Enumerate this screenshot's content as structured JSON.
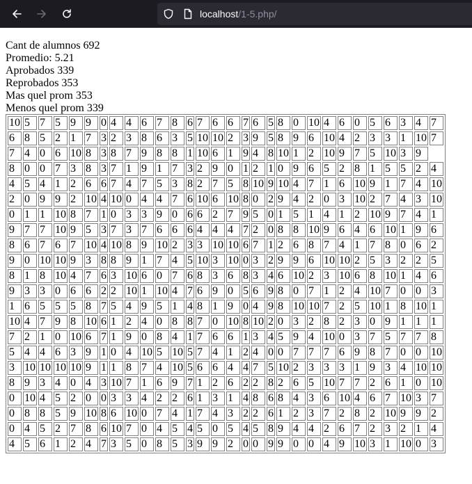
{
  "browser": {
    "url_host": "localhost",
    "url_path": "/1-5.php/"
  },
  "stats": {
    "cant": "Cant de alumnos 692",
    "promedio": "Promedio: 5.21",
    "aprobados": "Aprobados 339",
    "reprobados": "Reprobados 353",
    "mas": "Mas quel prom 353",
    "menos": "Menos quel prom 339"
  },
  "grid": [
    [
      "10",
      "5",
      "7",
      "5",
      "9",
      "9",
      "0",
      "4",
      "4",
      "6",
      "7",
      "8",
      "6",
      "7",
      "6",
      "6",
      "7",
      "6",
      "5",
      "8",
      "0",
      "10",
      "4",
      "6",
      "0",
      "5",
      "6",
      "3",
      "4",
      "7"
    ],
    [
      "6",
      "8",
      "5",
      "2",
      "1",
      "7",
      "3",
      "2",
      "3",
      "8",
      "6",
      "3",
      "5",
      "10",
      "10",
      "2",
      "3",
      "9",
      "5",
      "8",
      "9",
      "6",
      "10",
      "4",
      "2",
      "3",
      "3",
      "1",
      "10",
      "7"
    ],
    [
      "7",
      "4",
      "0",
      "6",
      "10",
      "8",
      "3",
      "8",
      "7",
      "9",
      "8",
      "8",
      "1",
      "10",
      "6",
      "1",
      "9",
      "4",
      "8",
      "10",
      "1",
      "2",
      "10",
      "9",
      "7",
      "5",
      "10",
      "3",
      "9"
    ],
    [
      "8",
      "0",
      "0",
      "7",
      "3",
      "8",
      "3",
      "7",
      "1",
      "9",
      "1",
      "7",
      "3",
      "2",
      "9",
      "0",
      "1",
      "2",
      "1",
      "0",
      "9",
      "6",
      "5",
      "2",
      "8",
      "1",
      "5",
      "5",
      "2",
      "4"
    ],
    [
      "4",
      "5",
      "4",
      "1",
      "2",
      "6",
      "6",
      "7",
      "4",
      "7",
      "5",
      "3",
      "8",
      "2",
      "7",
      "5",
      "8",
      "10",
      "9",
      "10",
      "4",
      "7",
      "1",
      "6",
      "10",
      "9",
      "1",
      "7",
      "4",
      "10"
    ],
    [
      "2",
      "0",
      "9",
      "9",
      "2",
      "10",
      "4",
      "10",
      "0",
      "4",
      "4",
      "7",
      "6",
      "10",
      "6",
      "10",
      "8",
      "0",
      "2",
      "9",
      "4",
      "2",
      "0",
      "3",
      "10",
      "2",
      "7",
      "4",
      "3",
      "10"
    ],
    [
      "0",
      "1",
      "1",
      "10",
      "8",
      "7",
      "1",
      "0",
      "3",
      "3",
      "9",
      "0",
      "6",
      "6",
      "2",
      "7",
      "9",
      "5",
      "0",
      "1",
      "5",
      "1",
      "4",
      "1",
      "2",
      "10",
      "9",
      "7",
      "4",
      "1"
    ],
    [
      "9",
      "7",
      "7",
      "10",
      "9",
      "5",
      "3",
      "7",
      "3",
      "7",
      "6",
      "6",
      "6",
      "4",
      "4",
      "4",
      "7",
      "2",
      "0",
      "8",
      "8",
      "10",
      "9",
      "6",
      "4",
      "6",
      "10",
      "1",
      "9",
      "6"
    ],
    [
      "8",
      "6",
      "7",
      "6",
      "7",
      "10",
      "4",
      "10",
      "8",
      "9",
      "10",
      "2",
      "3",
      "3",
      "10",
      "10",
      "6",
      "7",
      "1",
      "2",
      "6",
      "8",
      "7",
      "4",
      "1",
      "7",
      "8",
      "0",
      "6",
      "2"
    ],
    [
      "9",
      "0",
      "10",
      "10",
      "9",
      "3",
      "8",
      "8",
      "9",
      "1",
      "7",
      "4",
      "5",
      "10",
      "3",
      "10",
      "0",
      "3",
      "2",
      "9",
      "9",
      "6",
      "10",
      "10",
      "2",
      "5",
      "3",
      "2",
      "2",
      "5"
    ],
    [
      "8",
      "1",
      "8",
      "10",
      "4",
      "7",
      "6",
      "3",
      "10",
      "6",
      "0",
      "7",
      "6",
      "8",
      "3",
      "6",
      "8",
      "3",
      "4",
      "6",
      "10",
      "2",
      "3",
      "10",
      "6",
      "8",
      "10",
      "1",
      "4",
      "6"
    ],
    [
      "9",
      "3",
      "3",
      "0",
      "6",
      "6",
      "2",
      "2",
      "10",
      "1",
      "10",
      "4",
      "7",
      "6",
      "9",
      "0",
      "5",
      "6",
      "9",
      "8",
      "0",
      "7",
      "1",
      "2",
      "4",
      "10",
      "7",
      "0",
      "0",
      "3"
    ],
    [
      "1",
      "6",
      "5",
      "5",
      "5",
      "8",
      "7",
      "5",
      "4",
      "9",
      "5",
      "1",
      "4",
      "8",
      "1",
      "9",
      "0",
      "4",
      "9",
      "8",
      "10",
      "10",
      "7",
      "2",
      "5",
      "10",
      "1",
      "8",
      "10",
      "1"
    ],
    [
      "10",
      "4",
      "7",
      "9",
      "8",
      "10",
      "6",
      "1",
      "2",
      "4",
      "0",
      "8",
      "8",
      "7",
      "0",
      "10",
      "8",
      "10",
      "2",
      "0",
      "3",
      "2",
      "8",
      "2",
      "3",
      "0",
      "9",
      "1",
      "1",
      "1"
    ],
    [
      "7",
      "2",
      "1",
      "0",
      "10",
      "6",
      "7",
      "1",
      "9",
      "0",
      "8",
      "4",
      "1",
      "7",
      "6",
      "6",
      "1",
      "3",
      "4",
      "5",
      "9",
      "4",
      "10",
      "0",
      "3",
      "7",
      "5",
      "7",
      "7",
      "8"
    ],
    [
      "5",
      "4",
      "4",
      "6",
      "3",
      "9",
      "1",
      "0",
      "4",
      "10",
      "5",
      "10",
      "5",
      "7",
      "4",
      "1",
      "2",
      "4",
      "0",
      "0",
      "7",
      "7",
      "7",
      "6",
      "9",
      "8",
      "7",
      "0",
      "0",
      "10"
    ],
    [
      "3",
      "10",
      "10",
      "10",
      "10",
      "9",
      "1",
      "1",
      "8",
      "7",
      "4",
      "10",
      "5",
      "6",
      "6",
      "4",
      "4",
      "7",
      "5",
      "10",
      "2",
      "3",
      "3",
      "3",
      "1",
      "9",
      "3",
      "4",
      "10",
      "10"
    ],
    [
      "8",
      "9",
      "3",
      "4",
      "0",
      "4",
      "3",
      "10",
      "7",
      "1",
      "6",
      "9",
      "7",
      "1",
      "2",
      "6",
      "2",
      "2",
      "8",
      "2",
      "6",
      "5",
      "10",
      "7",
      "7",
      "2",
      "6",
      "1",
      "0",
      "10"
    ],
    [
      "0",
      "10",
      "4",
      "5",
      "2",
      "0",
      "0",
      "3",
      "3",
      "4",
      "2",
      "2",
      "6",
      "1",
      "3",
      "1",
      "4",
      "8",
      "6",
      "8",
      "4",
      "3",
      "6",
      "10",
      "4",
      "6",
      "7",
      "10",
      "3",
      "7"
    ],
    [
      "0",
      "8",
      "8",
      "5",
      "9",
      "10",
      "8",
      "6",
      "10",
      "0",
      "7",
      "4",
      "1",
      "7",
      "4",
      "3",
      "2",
      "2",
      "6",
      "1",
      "2",
      "3",
      "7",
      "2",
      "8",
      "2",
      "10",
      "9",
      "9",
      "2"
    ],
    [
      "0",
      "4",
      "5",
      "2",
      "7",
      "8",
      "6",
      "10",
      "7",
      "0",
      "4",
      "5",
      "4",
      "5",
      "0",
      "5",
      "4",
      "5",
      "8",
      "9",
      "4",
      "4",
      "2",
      "6",
      "7",
      "2",
      "3",
      "2",
      "1",
      "4"
    ],
    [
      "4",
      "5",
      "6",
      "1",
      "2",
      "4",
      "7",
      "3",
      "5",
      "0",
      "8",
      "5",
      "3",
      "9",
      "9",
      "2",
      "0",
      "0",
      "9",
      "9",
      "0",
      "0",
      "4",
      "9",
      "10",
      "3",
      "1",
      "10",
      "0",
      "3"
    ]
  ]
}
